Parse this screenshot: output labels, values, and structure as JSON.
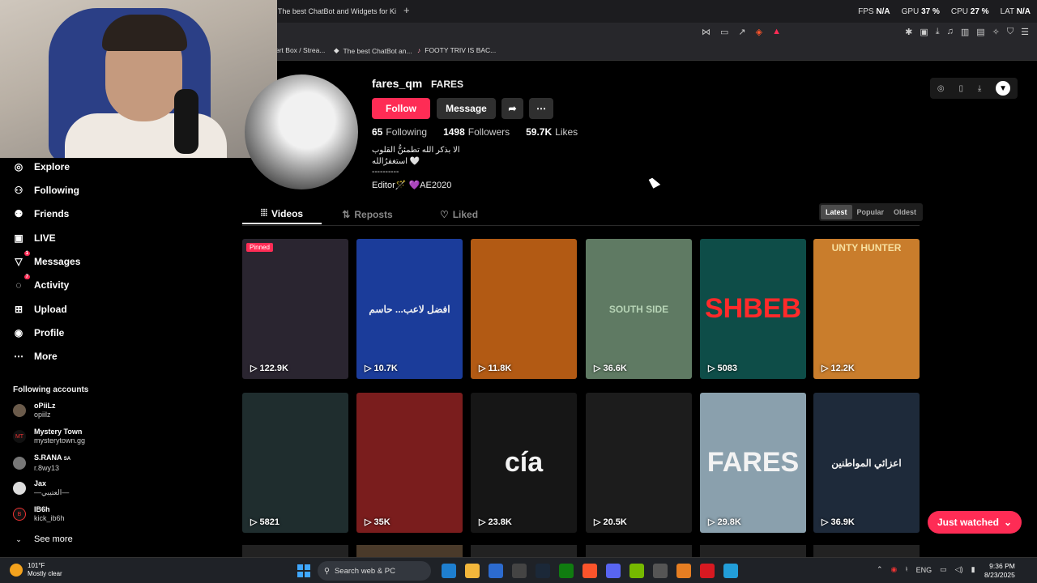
{
  "browser": {
    "tab_title": "The best ChatBot and Widgets for Ki",
    "tab_plus": "+",
    "stats": [
      {
        "label": "FPS",
        "value": "N/A"
      },
      {
        "label": "GPU",
        "value": "37 %"
      },
      {
        "label": "CPU",
        "value": "27 %"
      },
      {
        "label": "LAT",
        "value": "N/A"
      }
    ],
    "bookmarks": [
      {
        "label": "ert Box / Strea...",
        "icon": "bookmark-icon"
      },
      {
        "label": "The best ChatBot an...",
        "icon": "diamond-icon"
      },
      {
        "label": "FOOTY TRIV IS BAC...",
        "icon": "music-icon"
      }
    ]
  },
  "sidebar": {
    "items": [
      {
        "label": "Explore",
        "icon": "compass-icon",
        "top": 0
      },
      {
        "label": "Following",
        "icon": "following-icon"
      },
      {
        "label": "Friends",
        "icon": "friends-icon"
      },
      {
        "label": "LIVE",
        "icon": "live-icon"
      },
      {
        "label": "Messages",
        "icon": "messages-icon",
        "badge": "1"
      },
      {
        "label": "Activity",
        "icon": "activity-icon",
        "badge": "7"
      },
      {
        "label": "Upload",
        "icon": "upload-icon"
      },
      {
        "label": "Profile",
        "icon": "profile-icon"
      },
      {
        "label": "More",
        "icon": "more-icon"
      }
    ],
    "following_title": "Following accounts",
    "accounts": [
      {
        "name": "oPiiLz",
        "handle": "opiilz",
        "avatar": ""
      },
      {
        "name": "Mystery Town",
        "handle": "mysterytown.gg",
        "avatar": "MT"
      },
      {
        "name": "S.RANA",
        "handle": "r.8wy13",
        "avatar": "",
        "suffix": "SA"
      },
      {
        "name": "Jax",
        "handle": "—العتيبي—",
        "avatar": ""
      },
      {
        "name": "IB6h",
        "handle": "kick_ib6h",
        "avatar": ""
      }
    ],
    "see_more": "See more"
  },
  "profile": {
    "username": "fares_qm",
    "nickname": "FARES",
    "follow_label": "Follow",
    "message_label": "Message",
    "following_count": "65",
    "following_label": "Following",
    "followers_count": "1498",
    "followers_label": "Followers",
    "likes_count": "59.7K",
    "likes_label": "Likes",
    "bio_lines": [
      "الا بذكر الله تطمئنُّ القلوب",
      "استغفرُالله 🤍",
      "----------",
      "Editor🪄 💜AE2020"
    ]
  },
  "tabs": [
    {
      "label": "Videos",
      "icon": "grid-icon",
      "active": true
    },
    {
      "label": "Reposts",
      "icon": "repost-icon",
      "active": false
    },
    {
      "label": "Liked",
      "icon": "heart-icon",
      "active": false
    }
  ],
  "sort": [
    {
      "label": "Latest",
      "active": true
    },
    {
      "label": "Popular",
      "active": false
    },
    {
      "label": "Oldest",
      "active": false
    }
  ],
  "videos": [
    {
      "views": "122.9K",
      "pinned": "Pinned",
      "bg": "#2a2530",
      "overlay": ""
    },
    {
      "views": "10.7K",
      "bg": "#1b3c9a",
      "overlay": "افضل لاعب... حاسم"
    },
    {
      "views": "11.8K",
      "bg": "#b25a14",
      "overlay": ""
    },
    {
      "views": "36.6K",
      "bg": "#5f7a63",
      "overlay": "SOUTH SIDE"
    },
    {
      "views": "5083",
      "bg": "#0e4d48",
      "overlay": "SHBEB"
    },
    {
      "views": "12.2K",
      "bg": "#c97d2c",
      "overlay": "UNTY HUNTER"
    },
    {
      "views": "5821",
      "bg": "#1f2d2e",
      "overlay": ""
    },
    {
      "views": "35K",
      "bg": "#7a1d1d",
      "overlay": ""
    },
    {
      "views": "23.8K",
      "bg": "#161616",
      "overlay": "cía"
    },
    {
      "views": "20.5K",
      "bg": "#1c1c1c",
      "overlay": ""
    },
    {
      "views": "29.8K",
      "bg": "#8aa0ad",
      "overlay": "FARES"
    },
    {
      "views": "36.9K",
      "bg": "#1e2a3a",
      "overlay": "اعزائي المواطنين"
    }
  ],
  "just_watched": "Just watched",
  "taskbar": {
    "temp": "101°F",
    "weather": "Mostly clear",
    "search": "Search web & PC",
    "lang": "ENG",
    "time": "9:36 PM",
    "date": "8/23/2025"
  },
  "colors": {
    "accent": "#fe2c55",
    "bg": "#000000"
  }
}
